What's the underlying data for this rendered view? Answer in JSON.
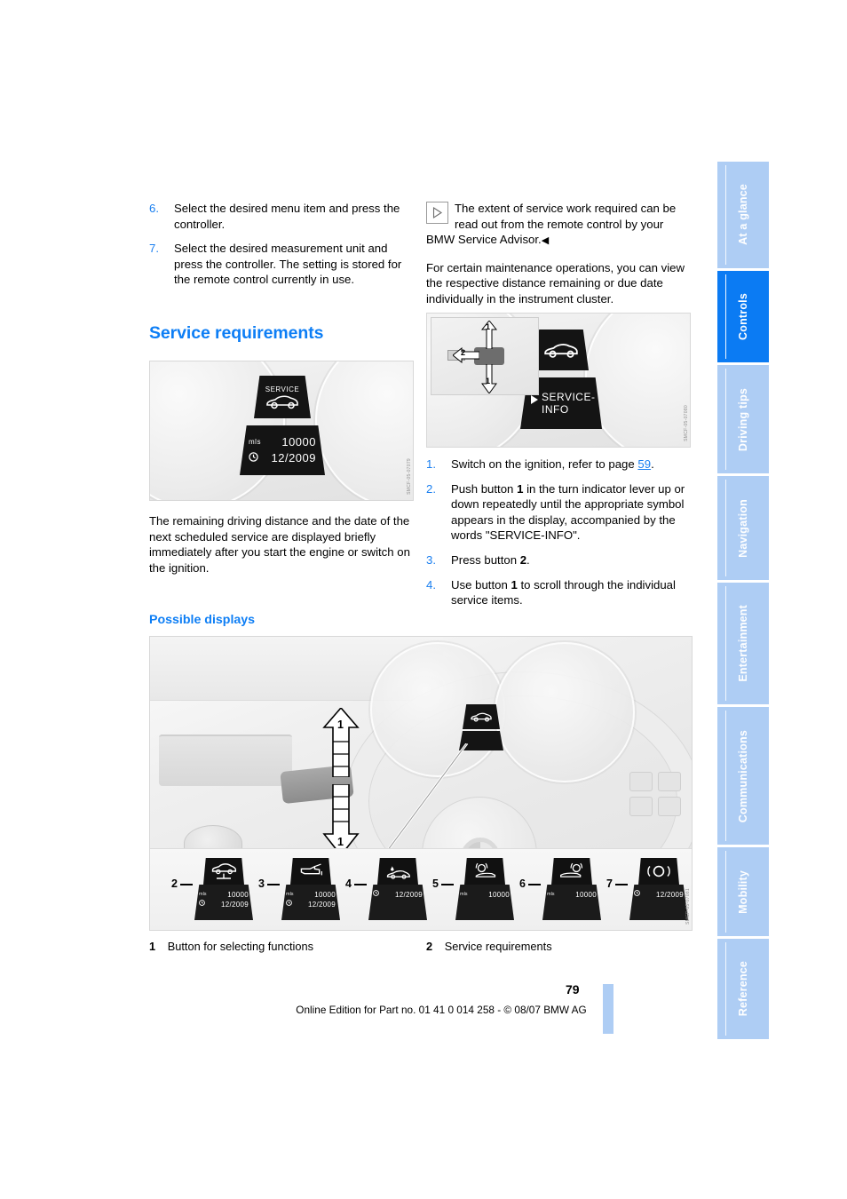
{
  "page": {
    "number": "79",
    "footer": "Online Edition for Part no. 01 41 0 014 258 - © 08/07 BMW AG"
  },
  "sidebar": {
    "items": [
      {
        "label": "At a glance",
        "active": false
      },
      {
        "label": "Controls",
        "active": true
      },
      {
        "label": "Driving tips",
        "active": false
      },
      {
        "label": "Navigation",
        "active": false
      },
      {
        "label": "Entertainment",
        "active": false
      },
      {
        "label": "Communications",
        "active": false
      },
      {
        "label": "Mobility",
        "active": false
      },
      {
        "label": "Reference",
        "active": false
      }
    ]
  },
  "left_column": {
    "steps": [
      {
        "num": "6.",
        "text": "Select the desired menu item and press the controller."
      },
      {
        "num": "7.",
        "text": "Select the desired measurement unit and press the controller. The setting is stored for the remote control currently in use."
      }
    ],
    "heading": "Service requirements",
    "figure1": {
      "code": "SMCF-05-07079",
      "display_title": "SERVICE",
      "unit_label": "mls",
      "distance": "10000",
      "date": "12/2009"
    },
    "paragraph": "The remaining driving distance and the date of the next scheduled service are displayed briefly immediately after you start the engine or switch on the ignition.",
    "subheading": "Possible displays"
  },
  "right_column": {
    "note": {
      "icon": "triangle-right-icon",
      "text": "The extent of service work required can be read out from the remote control by your BMW Service Advisor.",
      "end_mark": "◀"
    },
    "paragraph": "For certain maintenance operations, you can view the respective distance remaining or due date individually in the instrument cluster.",
    "figure2": {
      "code": "SMCF-05-07080",
      "display_text_line1": "SERVICE-",
      "display_text_line2": "INFO",
      "callout_up": "1",
      "callout_down": "1",
      "callout_button": "2"
    },
    "steps": [
      {
        "num": "1.",
        "pre": "Switch on the ignition, refer to page ",
        "link": "59",
        "post": "."
      },
      {
        "num": "2.",
        "pre": "Push button ",
        "bold": "1",
        "post": " in the turn indicator lever up or down repeatedly until the appropriate symbol appears in the display, accompanied by the words \"SERVICE-INFO\"."
      },
      {
        "num": "3.",
        "pre": "Press button ",
        "bold": "2",
        "post": "."
      },
      {
        "num": "4.",
        "pre": "Use button ",
        "bold": "1",
        "post": " to scroll through the individual service items."
      }
    ]
  },
  "main_figure": {
    "code": "SMCF-05-07081",
    "arrow_up_label": "1",
    "arrow_down_label": "1",
    "displays": [
      {
        "num": "2",
        "icon": "car-on-lift-icon",
        "unit": "mls",
        "distance": "10000",
        "date": "12/2009"
      },
      {
        "num": "3",
        "icon": "oil-can-icon",
        "unit": "mls",
        "distance": "10000",
        "date": "12/2009"
      },
      {
        "num": "4",
        "icon": "brake-fluid-car-icon",
        "unit": "",
        "distance": "",
        "date": "12/2009"
      },
      {
        "num": "5",
        "icon": "brake-pad-front-icon",
        "unit": "mls",
        "distance": "10000",
        "date": ""
      },
      {
        "num": "6",
        "icon": "brake-pad-rear-icon",
        "unit": "mls",
        "distance": "10000",
        "date": ""
      },
      {
        "num": "7",
        "icon": "vehicle-check-icon",
        "unit": "",
        "distance": "",
        "date": "12/2009"
      }
    ]
  },
  "legend": {
    "item1_num": "1",
    "item1_label": "Button for selecting functions",
    "item2_num": "2",
    "item2_label": "Service requirements"
  },
  "colors": {
    "accent_blue": "#0d7ef5",
    "tab_blue": "#aecdf4",
    "tab_active": "#0b7bf3"
  }
}
